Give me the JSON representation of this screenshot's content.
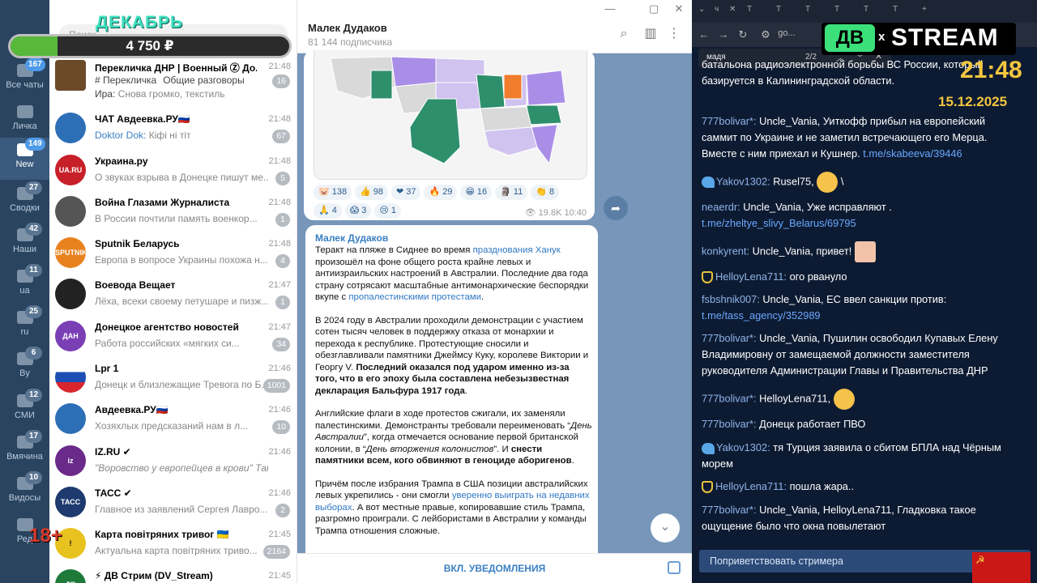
{
  "overlay": {
    "month": "ДЕКАБРЬ",
    "amount": "4 750 ₽",
    "progress": 0.17
  },
  "folders": [
    {
      "label": "Все чаты",
      "badge": "167",
      "active": false
    },
    {
      "label": "Личка",
      "badge": "",
      "active": false
    },
    {
      "label": "New",
      "badge": "149",
      "active": true
    },
    {
      "label": "Сводки",
      "badge": "27",
      "active": false
    },
    {
      "label": "Наши",
      "badge": "42",
      "active": false
    },
    {
      "label": "ua",
      "badge": "11",
      "active": false
    },
    {
      "label": "ru",
      "badge": "25",
      "active": false
    },
    {
      "label": "By",
      "badge": "6",
      "active": false
    },
    {
      "label": "СМИ",
      "badge": "12",
      "active": false
    },
    {
      "label": "Вмячина",
      "badge": "17",
      "active": false
    },
    {
      "label": "Видосы",
      "badge": "10",
      "active": false
    },
    {
      "label": "Ред",
      "badge": "",
      "active": false
    }
  ],
  "search_placeholder": "Поиск",
  "chats": [
    {
      "title": "Перекличка ДНР | Военный Ⓩ До...",
      "time": "21:48",
      "tags": [
        "# Перекличка",
        "Общие разговоры"
      ],
      "preview_sender": "Ира:",
      "preview": "Снова громко, текстиль",
      "badge": "16",
      "color": "#6b4a2a"
    },
    {
      "title": "ЧАТ Авдеевка.РУ🇷🇺",
      "time": "21:48",
      "preview_sender": "Doktor Dok:",
      "preview": "Кiфi нi тiт",
      "badge": "67",
      "color": "#2d6fb7"
    },
    {
      "title": "Украина.ру",
      "time": "21:48",
      "preview_sender": "",
      "preview": "О звуках взрыва в Донецке пишут ме...",
      "badge": "5",
      "color": "#c8202a"
    },
    {
      "title": "Война Глазами Журналиста",
      "time": "21:48",
      "preview_sender": "",
      "preview": "В России почтили память военкор...",
      "badge": "1",
      "color": "#555555"
    },
    {
      "title": "Sputnik Беларусь",
      "time": "21:48",
      "preview_sender": "",
      "preview": "Европа в вопросе Украины похожа н...",
      "badge": "4",
      "color": "#e8821e"
    },
    {
      "title": "Воевода Вещает",
      "time": "21:47",
      "preview_sender": "",
      "preview": "Лёха, всеки своему петушаре и пизж...",
      "badge": "1",
      "color": "#222222"
    },
    {
      "title": "Донецкое агентство новостей",
      "time": "21:47",
      "preview_sender": "",
      "preview": "Работа российских «мягких си...",
      "badge": "34",
      "color": "#7a3fb5"
    },
    {
      "title": "Lpr 1",
      "time": "21:46",
      "preview_sender": "",
      "preview": "Донецк и близлежащие Тревога по Б...",
      "badge": "1001",
      "color": "#d9262e"
    },
    {
      "title": "Авдеевка.РУ🇷🇺",
      "time": "21:46",
      "preview_sender": "",
      "preview": "Хозяхлых предсказаний нам в л...",
      "badge": "10",
      "color": "#2d6fb7"
    },
    {
      "title": "IZ.RU ✔",
      "time": "21:46",
      "preview_sender": "",
      "preview": "\"Воровство у европейцев в крови\" Так г...",
      "badge": "",
      "color": "#6a2a8a"
    },
    {
      "title": "ТАСС ✔",
      "time": "21:46",
      "preview_sender": "",
      "preview": "Главное из заявлений Сергея Лавро...",
      "badge": "2",
      "color": "#1e3a6e"
    },
    {
      "title": "Карта повітряних тривог 🇺🇦",
      "time": "21:45",
      "preview_sender": "",
      "preview": "Актуальна карта повітряних триво...",
      "badge": "2164",
      "color": "#e8c21e"
    },
    {
      "title": "⚡ ДВ Стрим (DV_Stream)",
      "time": "21:45",
      "preview_sender": "",
      "preview": "",
      "badge": "",
      "color": "#1f7a3a"
    }
  ],
  "channel": {
    "title": "Малек Дудаков",
    "subscribers": "81 144 подписчика"
  },
  "msg1": {
    "reactions": [
      {
        "emoji": "🐷",
        "count": "138"
      },
      {
        "emoji": "👍",
        "count": "98"
      },
      {
        "emoji": "❤",
        "count": "37"
      },
      {
        "emoji": "🔥",
        "count": "29"
      },
      {
        "emoji": "😁",
        "count": "16"
      },
      {
        "emoji": "🗿",
        "count": "11"
      },
      {
        "emoji": "👏",
        "count": "8"
      },
      {
        "emoji": "🙏",
        "count": "4"
      },
      {
        "emoji": "😱",
        "count": "3"
      },
      {
        "emoji": "😢",
        "count": "1"
      }
    ],
    "views": "19.8K",
    "time": "10:40"
  },
  "msg2": {
    "author": "Малек Дудаков",
    "p1a": "Теракт на пляже в Сиднее во время ",
    "p1link": "празднования Ханук",
    "p1b": " произошёл на фоне общего роста крайне левых и антиизраильских настроений в Австралии. Последние два года страну сотрясают масштабные антимонархические беспорядки вкупе с ",
    "p1link2": "пропалестинскими протестами",
    "p1c": ".",
    "p2a": "В 2024 году в Австралии проходили демонстрации с участием сотен тысяч человек в поддержку отказа от монархии и перехода к республике. Протестующие сносили и обезглавливали памятники Джеймсу Куку, королеве Виктории и Георгу V. ",
    "p2b": "Последний оказался под ударом именно из-за того, что в его эпоху была составлена небезызвестная декларация Бальфура 1917 года",
    "p2c": ".",
    "p3a": "Английские флаги в ходе протестов сжигали, их заменяли палестинскими. Демонстранты требовали переименовать “",
    "p3i1": "День Австралии",
    "p3b": "”, когда отмечается основание первой британской колонии, в “",
    "p3i2": "День вторжения колонистов",
    "p3c": "”. И ",
    "p3d": "снести памятники всем, кого обвиняют в геноциде аборигенов",
    "p3e": ".",
    "p4a": "Причём после избрания Трампа в США позиции австралийских левых укрепились - они смогли ",
    "p4link": "уверенно выиграть на недавних выборах",
    "p4b": ". А вот местные правые, копировавшие стиль Трампа, разгромно проиграли. С лейбористами в Австралии у команды Трампа отношения сложные."
  },
  "footer": {
    "notifications": "ВКЛ. УВЕДОМЛЕНИЯ"
  },
  "browser": {
    "url": "go...",
    "find_query": "мадя",
    "find_count": "2/2"
  },
  "stream_logo": {
    "db": "ДВ",
    "x": "x",
    "stream": "STREAM"
  },
  "clock": {
    "time": "21:48",
    "date": "15.12.2025"
  },
  "stream_chat": [
    {
      "user": "",
      "text": "батальона радиоэлектронной борьбы ВС России, который базируется в Калининградской области.",
      "link": ""
    },
    {
      "user": "777bolivar*:",
      "text": "Uncle_Vania, Уиткофф прибыл на европейский саммит по Украине и не заметил встречающего его Мерца. Вместе с ним приехал и Кушнер.",
      "link": "t.me/skabeeva/39446"
    },
    {
      "user": "Yakov1302:",
      "text": "Rusel75,",
      "link": ""
    },
    {
      "user": "neaerdr:",
      "text": "Uncle_Vania, Уже исправляют .",
      "link": "t.me/zheltye_slivy_Belarus/69795"
    },
    {
      "user": "konkyrent:",
      "text": "Uncle_Vania, привет!",
      "link": ""
    },
    {
      "user": "HelloyLena711:",
      "text": "ого рвануло",
      "link": ""
    },
    {
      "user": "fsbshnik007:",
      "text": "Uncle_Vania, ЕС ввел санкции против:",
      "link": "t.me/tass_agency/352989"
    },
    {
      "user": "777bolivar*:",
      "text": "Uncle_Vania, Пушилин освободил Купавых Елену Владимировну от замещаемой должности заместителя руководителя Администрации Главы и Правительства ДНР",
      "link": ""
    },
    {
      "user": "777bolivar*:",
      "text": "HelloyLena711,",
      "link": ""
    },
    {
      "user": "777bolivar*:",
      "text": "Донецк работает ПВО",
      "link": ""
    },
    {
      "user": "Yakov1302:",
      "text": "тя Турция заявила о сбитом БПЛА над Чёрным морем",
      "link": ""
    },
    {
      "user": "HelloyLena711:",
      "text": "пошла жара..",
      "link": ""
    },
    {
      "user": "777bolivar*:",
      "text": "Uncle_Vania, HelloyLena711, Гладковка такое ощущение было что окна повылетают",
      "link": ""
    }
  ],
  "greet_button": "Поприветствовать стримера",
  "age_label": "18+"
}
